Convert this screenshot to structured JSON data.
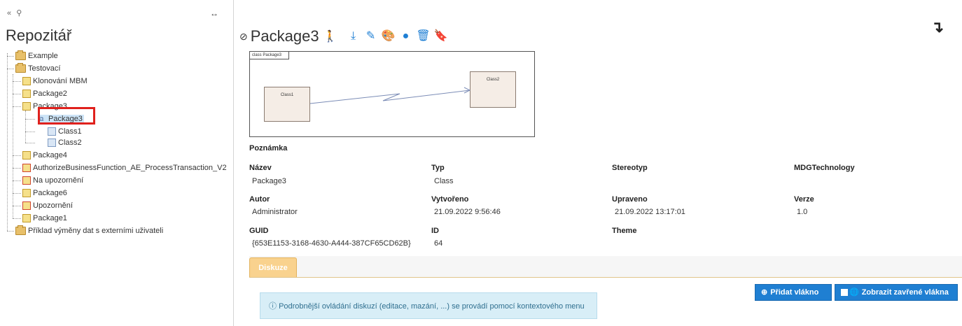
{
  "sidebar": {
    "title": "Repozitář",
    "tree": [
      {
        "label": "Example",
        "icon": "folder-icon"
      },
      {
        "label": "Testovací",
        "icon": "folder-icon"
      },
      {
        "label": "Klonování MBM",
        "icon": "package-icon"
      },
      {
        "label": "Package2",
        "icon": "package-icon"
      },
      {
        "label": "Package3",
        "icon": "package-icon"
      },
      {
        "label": "Package3",
        "icon": "diagram-icon",
        "selected": true
      },
      {
        "label": "Class1",
        "icon": "class-icon"
      },
      {
        "label": "Class2",
        "icon": "class-icon"
      },
      {
        "label": "Package4",
        "icon": "package-icon"
      },
      {
        "label": "AuthorizeBusinessFunction_AE_ProcessTransaction_V2",
        "icon": "package-red-icon"
      },
      {
        "label": "Na upozornění",
        "icon": "package-red-icon"
      },
      {
        "label": "Package6",
        "icon": "package-icon"
      },
      {
        "label": "Upozornění",
        "icon": "package-red-icon"
      },
      {
        "label": "Package1",
        "icon": "package-icon"
      },
      {
        "label": "Příklad výměny dat s externími uživateli",
        "icon": "folder-icon"
      }
    ]
  },
  "header": {
    "title": "Package3"
  },
  "diagram": {
    "tab_label": "class Package3",
    "class1": "Class1",
    "class2": "Class2"
  },
  "details": {
    "note_label": "Poznámka",
    "name_label": "Název",
    "name_value": "Package3",
    "type_label": "Typ",
    "type_value": "Class",
    "stereotype_label": "Stereotyp",
    "mdg_label": "MDGTechnology",
    "author_label": "Autor",
    "author_value": "Administrator",
    "created_label": "Vytvořeno",
    "created_value": "21.09.2022 9:56:46",
    "modified_label": "Upraveno",
    "modified_value": "21.09.2022 13:17:01",
    "version_label": "Verze",
    "version_value": "1.0",
    "guid_label": "GUID",
    "guid_value": "{653E1153-3168-4630-A444-387CF65CD62B}",
    "id_label": "ID",
    "id_value": "64",
    "theme_label": "Theme"
  },
  "discussion": {
    "tab_label": "Diskuze",
    "add_thread_label": "Přidat vlákno",
    "show_closed_label": "Zobrazit zavřené vlákna",
    "info_text": "Podrobnější ovládání diskuzí (editace, mazání, ...) se provádí pomocí kontextového menu"
  },
  "colors": {
    "accent": "#1f7fd2",
    "tab_active": "#f9d28e",
    "selection_outline": "#e0211d"
  }
}
